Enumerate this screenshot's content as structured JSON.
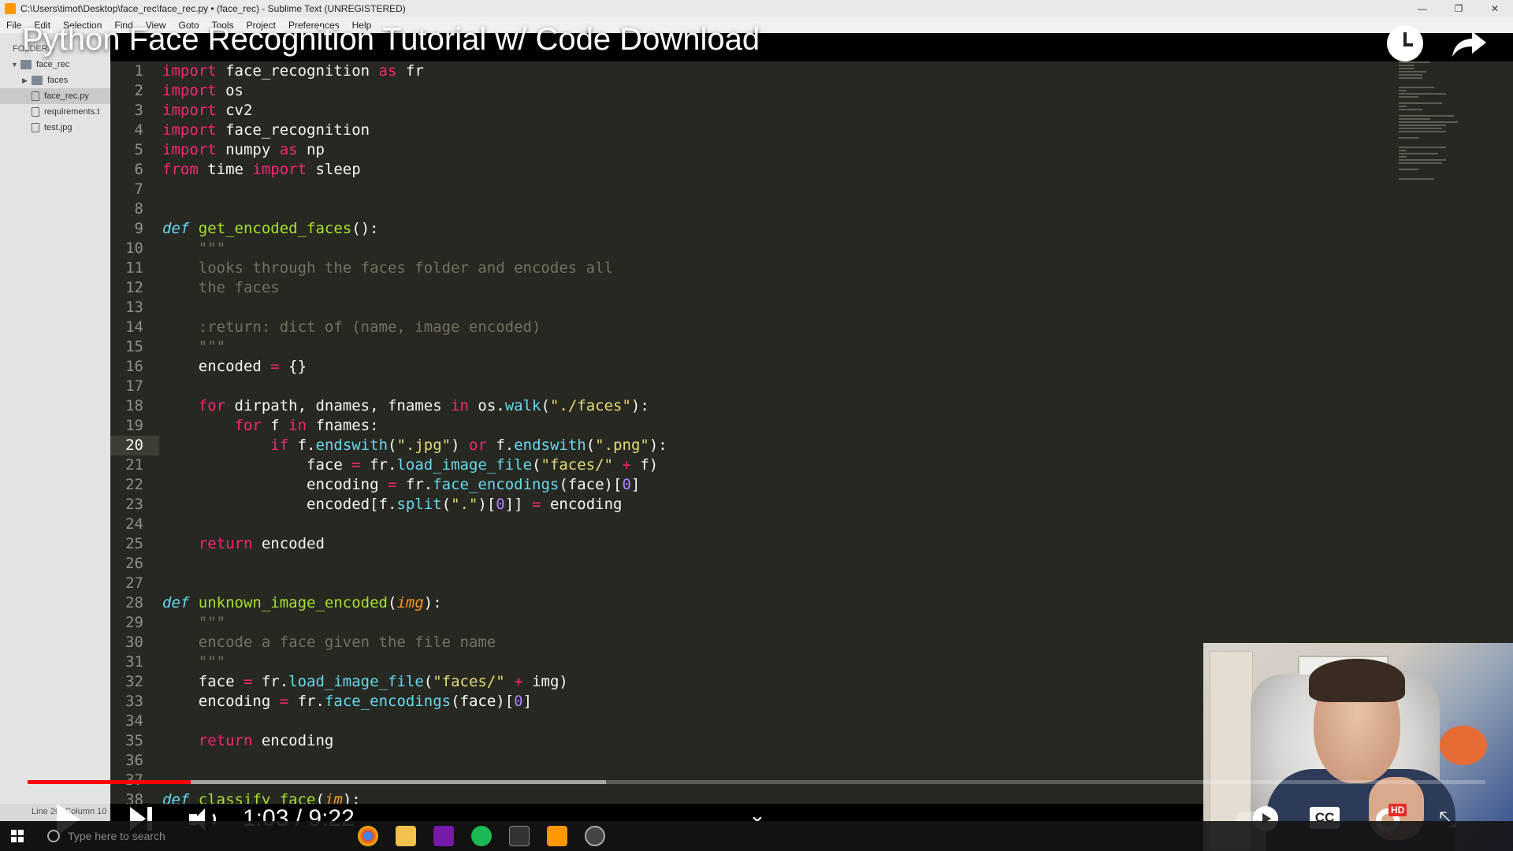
{
  "window": {
    "title": "C:\\Users\\timot\\Desktop\\face_rec\\face_rec.py • (face_rec) - Sublime Text (UNREGISTERED)",
    "controls": [
      "—",
      "❐",
      "✕"
    ]
  },
  "menubar": [
    "File",
    "Edit",
    "Selection",
    "Find",
    "View",
    "Goto",
    "Tools",
    "Project",
    "Preferences",
    "Help"
  ],
  "sidebar": {
    "header": "FOLDERS",
    "items": [
      {
        "label": "face_rec",
        "type": "folder-open"
      },
      {
        "label": "faces",
        "type": "folder"
      },
      {
        "label": "face_rec.py",
        "type": "file",
        "selected": true
      },
      {
        "label": "requirements.t",
        "type": "file"
      },
      {
        "label": "test.jpg",
        "type": "file"
      }
    ],
    "status": "Line 20, Column 10"
  },
  "editor": {
    "active_line": 20,
    "lines": [
      {
        "n": "1"
      },
      {
        "n": "2"
      },
      {
        "n": "3"
      },
      {
        "n": "4"
      },
      {
        "n": "5"
      },
      {
        "n": "6"
      },
      {
        "n": "7"
      },
      {
        "n": "8"
      },
      {
        "n": "9"
      },
      {
        "n": "10"
      },
      {
        "n": "11"
      },
      {
        "n": "12"
      },
      {
        "n": "13"
      },
      {
        "n": "14"
      },
      {
        "n": "15"
      },
      {
        "n": "16"
      },
      {
        "n": "17"
      },
      {
        "n": "18"
      },
      {
        "n": "19"
      },
      {
        "n": "20"
      },
      {
        "n": "21"
      },
      {
        "n": "22"
      },
      {
        "n": "23"
      },
      {
        "n": "24"
      },
      {
        "n": "25"
      },
      {
        "n": "26"
      },
      {
        "n": "27"
      },
      {
        "n": "28"
      },
      {
        "n": "29"
      },
      {
        "n": "30"
      },
      {
        "n": "31"
      },
      {
        "n": "32"
      },
      {
        "n": "33"
      },
      {
        "n": "34"
      },
      {
        "n": "35"
      },
      {
        "n": "36"
      },
      {
        "n": "37"
      },
      {
        "n": "38"
      }
    ],
    "code": {
      "l1": [
        "import",
        " face_recognition ",
        "as",
        " fr"
      ],
      "l2": [
        "import",
        " os"
      ],
      "l3": [
        "import",
        " cv2"
      ],
      "l4": [
        "import",
        " face_recognition"
      ],
      "l5": [
        "import",
        " numpy ",
        "as",
        " np"
      ],
      "l6": [
        "from",
        " time ",
        "import",
        " sleep"
      ],
      "l9": [
        "def",
        " ",
        "get_encoded_faces",
        "():"
      ],
      "l10": "    \"\"\"",
      "l11": "    looks through the faces folder and encodes all",
      "l12": "    the faces",
      "l14": "    :return: dict of (name, image encoded)",
      "l15": "    \"\"\"",
      "l16": [
        "    encoded ",
        "=",
        " {}"
      ],
      "l18": [
        "    ",
        "for",
        " dirpath, dnames, fnames ",
        "in",
        " os.",
        "walk",
        "(",
        "\"./faces\"",
        "):"
      ],
      "l19": [
        "        ",
        "for",
        " f ",
        "in",
        " fnames:"
      ],
      "l20": [
        "            ",
        "if",
        " f.",
        "endswith",
        "(",
        "\".jpg\"",
        ") ",
        "or",
        " f.",
        "endswith",
        "(",
        "\".png\"",
        "):"
      ],
      "l21": [
        "                face ",
        "=",
        " fr.",
        "load_image_file",
        "(",
        "\"faces/\"",
        " ",
        "+",
        " f)"
      ],
      "l22": [
        "                encoding ",
        "=",
        " fr.",
        "face_encodings",
        "(face)[",
        "0",
        "]"
      ],
      "l23": [
        "                encoded[f.",
        "split",
        "(",
        "\".\"",
        ")[",
        "0",
        "]] ",
        "=",
        " encoding"
      ],
      "l25": [
        "    ",
        "return",
        " encoded"
      ],
      "l28": [
        "def",
        " ",
        "unknown_image_encoded",
        "(",
        "img",
        "):"
      ],
      "l29": "    \"\"\"",
      "l30": "    encode a face given the file name",
      "l31": "    \"\"\"",
      "l32": [
        "    face ",
        "=",
        " fr.",
        "load_image_file",
        "(",
        "\"faces/\"",
        " ",
        "+",
        " img)"
      ],
      "l33": [
        "    encoding ",
        "=",
        " fr.",
        "face_encodings",
        "(face)[",
        "0",
        "]"
      ],
      "l35": [
        "    ",
        "return",
        " encoding"
      ],
      "l38": [
        "def",
        " ",
        "classify_face",
        "(",
        "im",
        "):"
      ]
    }
  },
  "video": {
    "title": "Python Face Recognition Tutorial w/ Code Download",
    "current_time": "1:03",
    "duration": "9:22",
    "time_display": "1:03 / 9:22",
    "progress_fraction": 0.112,
    "buffered_fraction": 0.397,
    "cc_label": "CC",
    "hd_badge": "HD",
    "accent_color": "#ff0000"
  },
  "taskbar": {
    "search_placeholder": "Type here to search",
    "apps": [
      "chrome",
      "file-explorer",
      "onenote",
      "spotify",
      "terminal",
      "sublime-text",
      "obs"
    ]
  },
  "colors": {
    "editor_bg": "#272822",
    "keyword": "#f92672",
    "function": "#a6e22e",
    "string": "#e6db74",
    "number": "#ae81ff",
    "comment": "#75715e",
    "builtin": "#66d9ef"
  }
}
